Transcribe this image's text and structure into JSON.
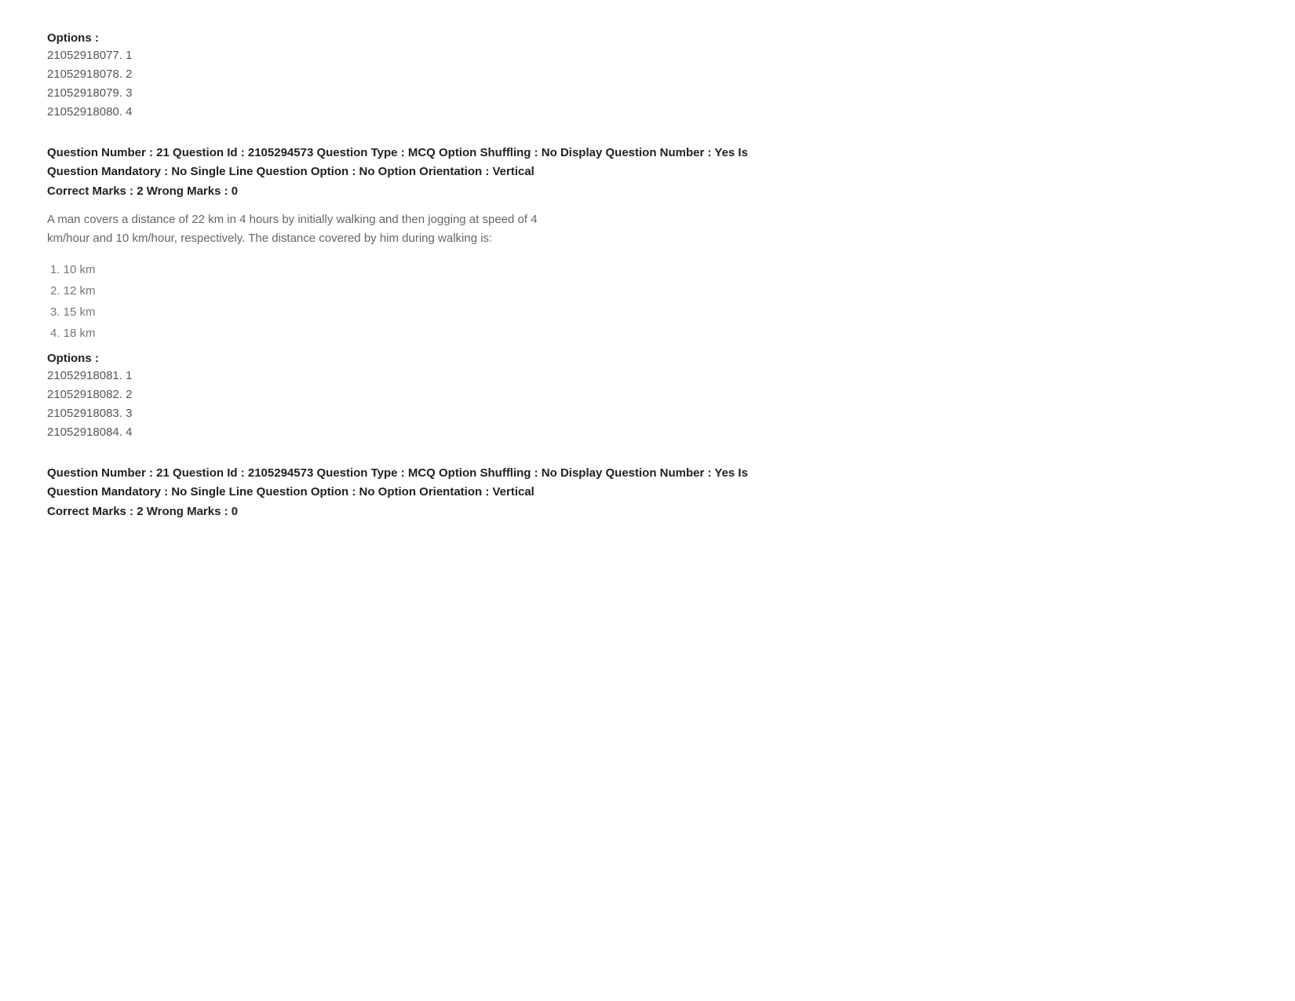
{
  "sections": [
    {
      "options_label": "Options :",
      "options": [
        {
          "id": "21052918077",
          "num": "1"
        },
        {
          "id": "21052918078",
          "num": "2"
        },
        {
          "id": "21052918079",
          "num": "3"
        },
        {
          "id": "21052918080",
          "num": "4"
        }
      ]
    },
    {
      "question_meta_line1": "Question Number : 21 Question Id : 2105294573 Question Type : MCQ Option Shuffling : No Display Question Number : Yes Is",
      "question_meta_line2": "Question Mandatory : No Single Line Question Option : No Option Orientation : Vertical",
      "marks": "Correct Marks : 2 Wrong Marks : 0",
      "question_text_line1": "A man covers a distance of 22 km in 4 hours by initially walking and then jogging at speed of 4",
      "question_text_line2": "km/hour and 10 km/hour, respectively. The distance covered by him during walking is:",
      "answer_options": [
        "1. 10 km",
        "2. 12 km",
        "3. 15 km",
        "4. 18 km"
      ],
      "options_label": "Options :",
      "options": [
        {
          "id": "21052918081",
          "num": "1"
        },
        {
          "id": "21052918082",
          "num": "2"
        },
        {
          "id": "21052918083",
          "num": "3"
        },
        {
          "id": "21052918084",
          "num": "4"
        }
      ]
    },
    {
      "question_meta_line1": "Question Number : 21 Question Id : 2105294573 Question Type : MCQ Option Shuffling : No Display Question Number : Yes Is",
      "question_meta_line2": "Question Mandatory : No Single Line Question Option : No Option Orientation : Vertical",
      "marks": "Correct Marks : 2 Wrong Marks : 0"
    }
  ]
}
